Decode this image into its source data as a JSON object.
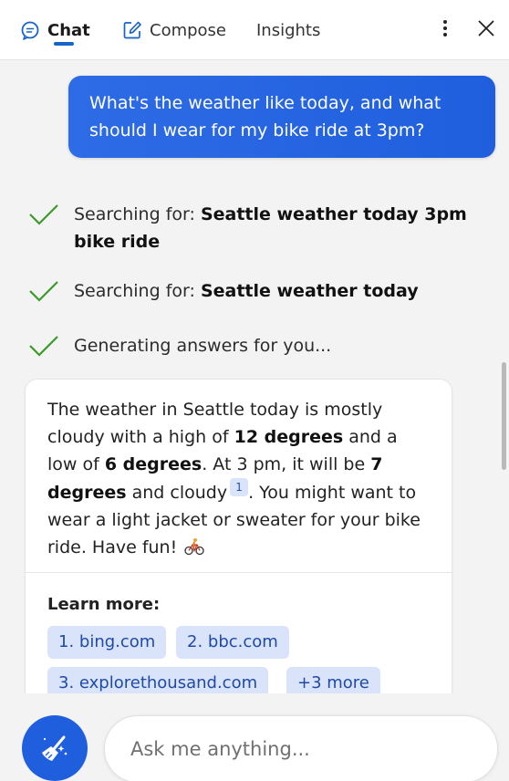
{
  "header": {
    "tabs": [
      {
        "label": "Chat",
        "icon": "chat-icon",
        "active": true
      },
      {
        "label": "Compose",
        "icon": "compose-icon",
        "active": false
      },
      {
        "label": "Insights",
        "active": false
      }
    ],
    "more_icon": "more-vertical-icon",
    "close_icon": "close-icon"
  },
  "conversation": {
    "user_message": "What's the weather like today, and what should I wear for my bike ride at 3pm?",
    "status_steps": [
      {
        "prefix": "Searching for: ",
        "query": "Seattle weather today 3pm bike ride"
      },
      {
        "prefix": "Searching for: ",
        "query": "Seattle weather today"
      },
      {
        "text": "Generating answers for you..."
      }
    ],
    "answer": {
      "t1": "The weather in Seattle today is mostly cloudy with a high of ",
      "b1": "12 degrees",
      "t2": " and a low of ",
      "b2": "6 degrees",
      "t3": ". At 3 pm, it will be ",
      "b3": "7 degrees",
      "t4": " and cloudy",
      "citation": "1",
      "t5": ". You might want to wear a light jacket or sweater for your bike ride. Have fun!",
      "emoji_icon": "bicyclist-icon"
    },
    "learn_more": {
      "title": "Learn more:",
      "links": [
        "1. bing.com",
        "2. bbc.com",
        "3. explorethousand.com",
        "+3 more"
      ]
    }
  },
  "footer": {
    "new_topic_icon": "broom-icon",
    "input_placeholder": "Ask me anything...",
    "input_value": ""
  },
  "colors": {
    "accent": "#1f5fdd",
    "check": "#3a9a2a",
    "chip_bg": "#d9e3fa"
  }
}
